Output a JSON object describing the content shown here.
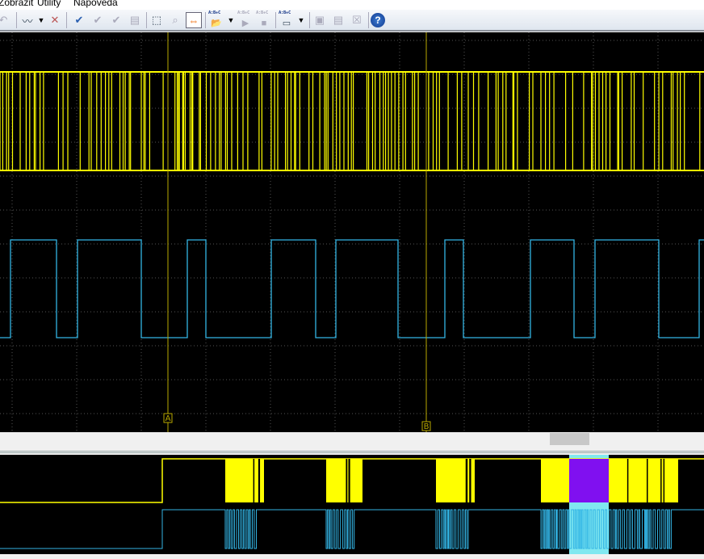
{
  "menu": {
    "items": [
      "Zobrazit",
      "Utility",
      "Napoveda"
    ]
  },
  "toolbar": {
    "buttons": [
      "undo-icon",
      "add-waveform-icon",
      "dropdown-icon",
      "delete-waveform-icon",
      "check-icon",
      "check-down-icon",
      "check-next-icon",
      "document-icon",
      "zoom-fit-icon",
      "zoom-search-icon",
      "cursor-measure-icon",
      "open-decoder-icon",
      "dropdown-icon",
      "decoder-run-icon",
      "decoder-stop-icon",
      "decoder-table-icon",
      "dropdown-icon",
      "waveform-export-icon",
      "report-icon",
      "clear-icon",
      "help-icon"
    ],
    "decoder_text": "A:B+C"
  },
  "cursors": {
    "a": "A",
    "b": "B"
  },
  "colors": {
    "ch1": "#ffff00",
    "ch2": "#33b5e5",
    "grid": "#555555",
    "cursor": "#b8a800",
    "highlight": "#8010f0",
    "highlight_bg": "#80e8f0"
  }
}
